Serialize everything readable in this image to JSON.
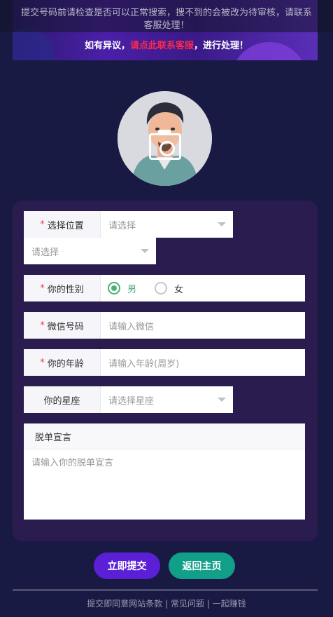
{
  "notice": "提交号码前请检查是否可以正常搜索，搜不到的会被改为待审核，请联系客服处理！",
  "dispute": {
    "prefix": "如有异议，",
    "link": "请点此联系客服",
    "suffix": "，进行处理！"
  },
  "avatar": {
    "icon": "camera-icon"
  },
  "form": {
    "location": {
      "label": "选择位置",
      "select1": "请选择",
      "select2": "请选择"
    },
    "gender": {
      "label": "你的性别",
      "options": [
        "男",
        "女"
      ],
      "selected": "男"
    },
    "wechat": {
      "label": "微信号码",
      "placeholder": "请输入微信"
    },
    "age": {
      "label": "你的年龄",
      "placeholder": "请输入年龄(周岁)"
    },
    "zodiac": {
      "label": "你的星座",
      "placeholder": "请选择星座"
    },
    "declaration": {
      "label": "脱单宣言",
      "placeholder": "请输入你的脱单宣言"
    }
  },
  "buttons": {
    "submit": "立即提交",
    "home": "返回主页"
  },
  "footer": {
    "terms": "提交即同意网站条款",
    "sep": " | ",
    "faq": "常见问题",
    "earn": "一起赚钱"
  },
  "colors": {
    "accent_purple": "#5b1fd6",
    "accent_teal": "#119f88",
    "link_red": "#ff2a4a",
    "background": "#181a43"
  }
}
